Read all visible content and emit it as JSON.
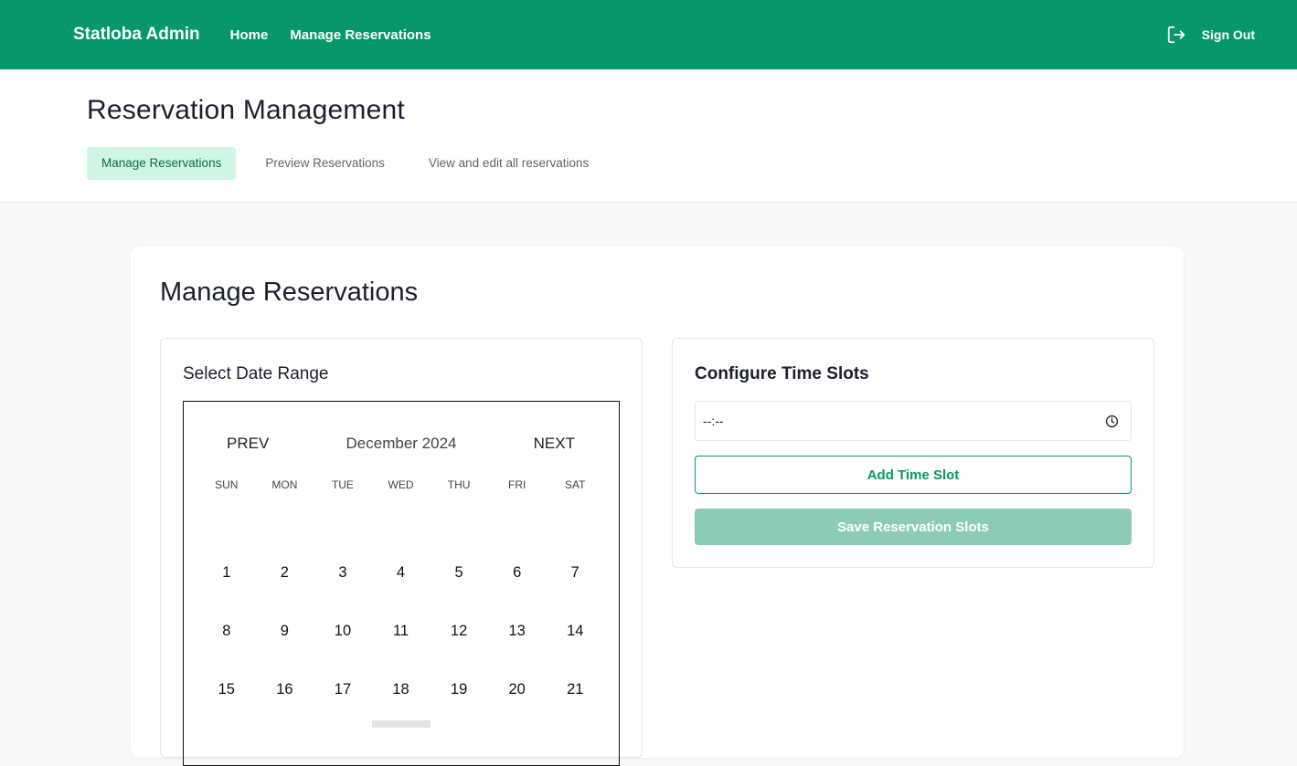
{
  "topbar": {
    "brand": "Statloba Admin",
    "nav": [
      "Home",
      "Manage Reservations"
    ],
    "signout_label": "Sign Out"
  },
  "header": {
    "title": "Reservation Management",
    "tabs": [
      "Manage Reservations",
      "Preview Reservations",
      "View and edit all reservations"
    ]
  },
  "card": {
    "title": "Manage Reservations",
    "date_panel": {
      "title": "Select Date Range",
      "calendar": {
        "prev": "PREV",
        "month": "December 2024",
        "next": "NEXT",
        "weekdays": [
          "SUN",
          "MON",
          "TUE",
          "WED",
          "THU",
          "FRI",
          "SAT"
        ],
        "weeks": [
          [
            "1",
            "2",
            "3",
            "4",
            "5",
            "6",
            "7"
          ],
          [
            "8",
            "9",
            "10",
            "11",
            "12",
            "13",
            "14"
          ],
          [
            "15",
            "16",
            "17",
            "18",
            "19",
            "20",
            "21"
          ]
        ]
      }
    },
    "time_panel": {
      "title": "Configure Time Slots",
      "time_value": "--:--",
      "add_label": "Add Time Slot",
      "save_label": "Save Reservation Slots"
    }
  },
  "colors": {
    "brand": "#06976a",
    "active_tab_bg": "#cff5e4",
    "save_disabled": "#8dcbb6"
  }
}
